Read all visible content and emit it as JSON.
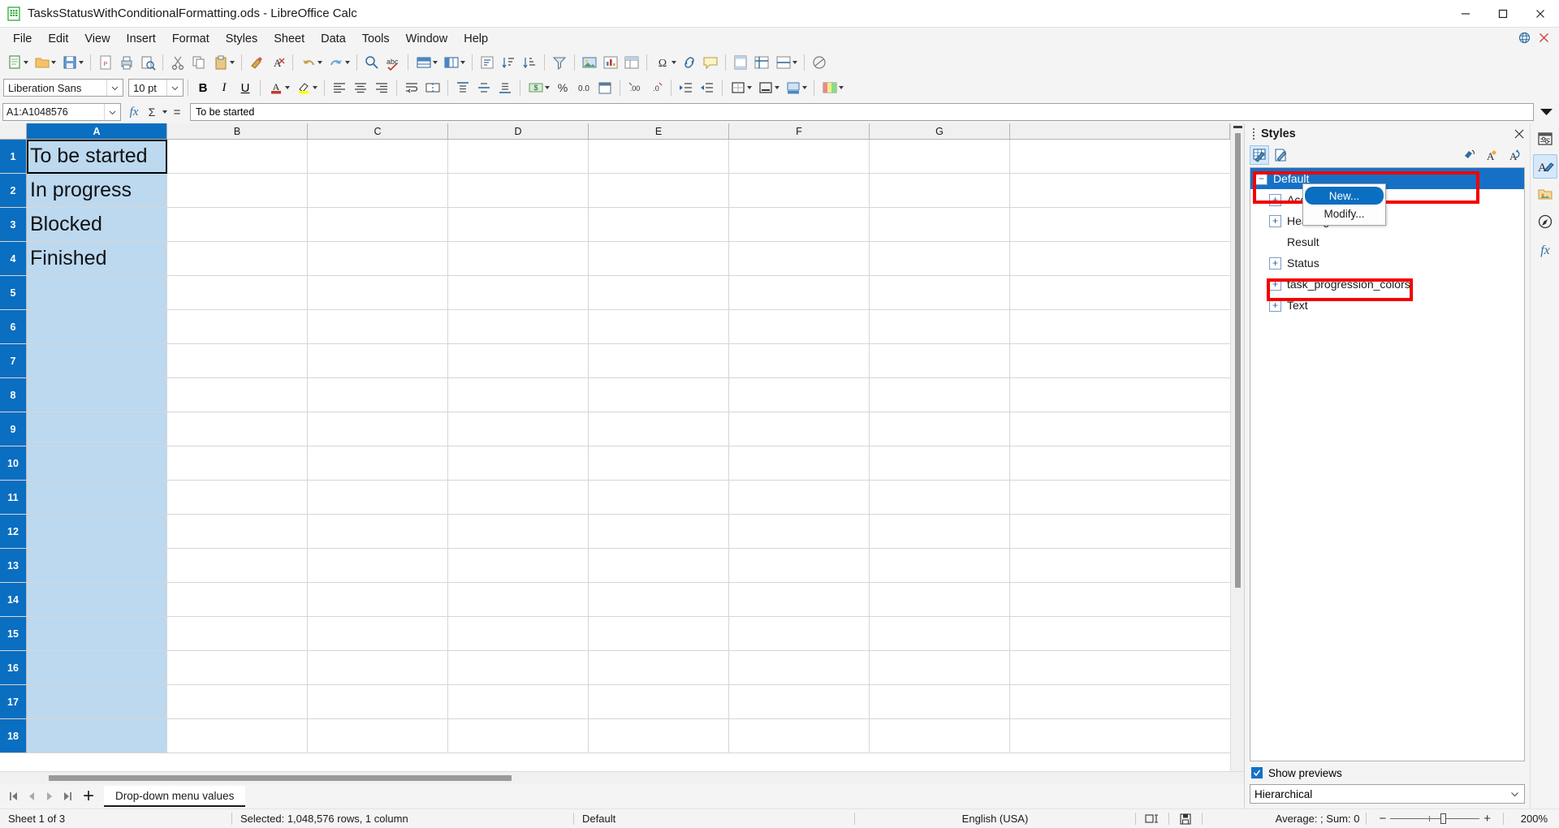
{
  "window": {
    "title": "TasksStatusWithConditionalFormatting.ods - LibreOffice Calc",
    "app_icon": "calc-document-icon",
    "minimize_label": "Minimize",
    "maximize_label": "Restore",
    "close_label": "Close"
  },
  "menubar": {
    "items": [
      {
        "label": "File"
      },
      {
        "label": "Edit"
      },
      {
        "label": "View"
      },
      {
        "label": "Insert"
      },
      {
        "label": "Format"
      },
      {
        "label": "Styles"
      },
      {
        "label": "Sheet"
      },
      {
        "label": "Data"
      },
      {
        "label": "Tools"
      },
      {
        "label": "Window"
      },
      {
        "label": "Help"
      }
    ]
  },
  "formatbar": {
    "font_name": "Liberation Sans",
    "font_size": "10 pt",
    "bold": "B",
    "italic": "I",
    "underline": "U"
  },
  "formulabar": {
    "name_box": "A1:A1048576",
    "function_wizard": "fx",
    "sum": "Σ",
    "equals": "=",
    "input_line": "To be started"
  },
  "grid": {
    "columns": [
      "A",
      "B",
      "C",
      "D",
      "E",
      "F",
      "G"
    ],
    "selected_column": "A",
    "rows": [
      "1",
      "2",
      "3",
      "4",
      "5",
      "6",
      "7",
      "8",
      "9",
      "10",
      "11",
      "12",
      "13",
      "14",
      "15",
      "16",
      "17",
      "18"
    ],
    "active_cell": "A1",
    "cells_col_a": [
      "To be started",
      "In progress",
      "Blocked",
      "Finished",
      "",
      "",
      "",
      "",
      "",
      "",
      "",
      "",
      "",
      "",
      "",
      "",
      "",
      ""
    ]
  },
  "sheettabs": {
    "first": "first-sheet",
    "prev": "previous-sheet",
    "next": "next-sheet",
    "last": "last-sheet",
    "add": "+",
    "tabs": [
      {
        "label": "Drop-down menu values",
        "active": true
      }
    ]
  },
  "styles_panel": {
    "title": "Styles",
    "close": "×",
    "toolbar": [
      {
        "name": "cell-styles-icon",
        "active": true
      },
      {
        "name": "page-styles-icon",
        "active": false
      },
      {
        "name": "fill-format-mode-icon",
        "active": false
      },
      {
        "name": "new-style-from-selection-icon",
        "active": false
      },
      {
        "name": "update-style-icon",
        "active": false
      }
    ],
    "tree": [
      {
        "label": "Default",
        "level": 0,
        "toggle": "minus",
        "selected": true,
        "highlighted": true
      },
      {
        "label": "Accent",
        "level": 1,
        "toggle": "plus",
        "selected": false,
        "highlighted": false
      },
      {
        "label": "Heading",
        "level": 1,
        "toggle": "plus",
        "selected": false,
        "highlighted": false
      },
      {
        "label": "Result",
        "level": 1,
        "toggle": "none",
        "selected": false,
        "highlighted": false
      },
      {
        "label": "Status",
        "level": 1,
        "toggle": "plus",
        "selected": false,
        "highlighted": false
      },
      {
        "label": "task_progression_colors",
        "level": 1,
        "toggle": "plus",
        "selected": false,
        "highlighted": true
      },
      {
        "label": "Text",
        "level": 1,
        "toggle": "plus",
        "selected": false,
        "highlighted": false
      }
    ],
    "context_menu": {
      "items": [
        {
          "label": "New...",
          "highlighted": true
        },
        {
          "label": "Modify...",
          "highlighted": false
        }
      ]
    },
    "show_previews_label": "Show previews",
    "show_previews_checked": true,
    "filter_value": "Hierarchical"
  },
  "sidebar_rail": {
    "items": [
      {
        "name": "sidebar-settings-icon"
      },
      {
        "name": "styles-icon",
        "active": true
      },
      {
        "name": "gallery-icon"
      },
      {
        "name": "navigator-icon"
      },
      {
        "name": "functions-icon"
      }
    ]
  },
  "statusbar": {
    "sheet": "Sheet 1 of 3",
    "selection": "Selected: 1,048,576 rows, 1 column",
    "page_style": "Default",
    "language": "English (USA)",
    "insert_mode_icon": "overwrite-mode-icon",
    "save_status_icon": "document-modified-icon",
    "average_sum": "Average: ; Sum: 0",
    "zoom_minus": "−",
    "zoom_plus": "+",
    "zoom_level": "200%"
  },
  "colors": {
    "accent": "#1671c6",
    "selection_header": "#0a6ec1",
    "cell_selection": "#bcd9f0",
    "annotation_red": "#f30000"
  }
}
